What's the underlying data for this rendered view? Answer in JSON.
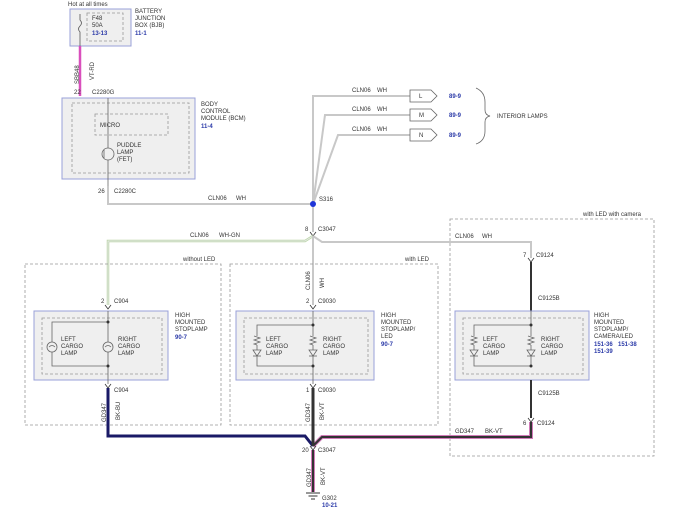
{
  "colors": {
    "wire": "#c8c8c8",
    "wire_pink": "#d94fbd",
    "ground_wire": "#333333",
    "ground_pink": "#d07ab8",
    "module_border": "#9aa0d8",
    "module_fill": "#efefef",
    "dash": "#999999",
    "ref": "#2b3aa8",
    "splice": "#1f35d8"
  },
  "top_note": "Hot at all times",
  "fuse": {
    "name": "F48",
    "rating": "50A",
    "ref": "13-13"
  },
  "bjb": {
    "line1": "BATTERY",
    "line2": "JUNCTION",
    "line3": "BOX (BJB)",
    "ref": "11-1"
  },
  "wire_top": {
    "circuit": "SBB48",
    "color": "VT-RD"
  },
  "bcm_top_conn": {
    "pin": "22",
    "name": "C2280G"
  },
  "bcm": {
    "line1": "BODY",
    "line2": "CONTROL",
    "line3": "MODULE (BCM)",
    "ref": "11-4"
  },
  "micro": "MICRO",
  "puddle": {
    "line1": "PUDDLE",
    "line2": "LAMP",
    "line3": "(FET)"
  },
  "bcm_bot_conn": {
    "pin": "26",
    "name": "C2280C"
  },
  "wire_s316": {
    "circuit": "CLN06",
    "color": "WH"
  },
  "splice_s316": "S316",
  "interior": {
    "circuit": "CLN06",
    "color": "WH",
    "rows": [
      {
        "conn": "L",
        "ref": "89-9"
      },
      {
        "conn": "M",
        "ref": "89-9"
      },
      {
        "conn": "N",
        "ref": "89-9"
      }
    ],
    "label": "INTERIOR LAMPS"
  },
  "c3047_top": {
    "pin": "8",
    "name": "C3047"
  },
  "wire_left": {
    "circuit": "CLN06",
    "color": "WH-GN"
  },
  "wire_right": {
    "circuit": "CLN06",
    "color": "WH"
  },
  "wire_mid_vert": {
    "circuit": "CLN06",
    "color": "WH"
  },
  "variant_left": "without LED",
  "variant_mid": "with LED",
  "variant_right": "with LED with camera",
  "left": {
    "top_conn": {
      "pin": "2",
      "name": "C904"
    },
    "bot_conn": {
      "pin": "",
      "name": "C904"
    },
    "lamp_l": {
      "line1": "LEFT",
      "line2": "CARGO",
      "line3": "LAMP"
    },
    "lamp_r": {
      "line1": "RIGHT",
      "line2": "CARGO",
      "line3": "LAMP"
    },
    "title": {
      "line1": "HIGH",
      "line2": "MOUNTED",
      "line3": "STOPLAMP",
      "ref": "90-7"
    },
    "gnd": {
      "circuit": "GD347",
      "color": "BK-BU"
    }
  },
  "mid": {
    "top_conn": {
      "pin": "2",
      "name": "C9030"
    },
    "bot_conn": {
      "pin": "1",
      "name": "C9030"
    },
    "lamp_l": {
      "line1": "LEFT",
      "line2": "CARGO",
      "line3": "LAMP"
    },
    "lamp_r": {
      "line1": "RIGHT",
      "line2": "CARGO",
      "line3": "LAMP"
    },
    "title": {
      "line1": "HIGH",
      "line2": "MOUNTED",
      "line3": "STOPLAMP/",
      "line4": "LED",
      "ref": "90-7"
    },
    "gnd": {
      "circuit": "GD347",
      "color": "BK-VT"
    }
  },
  "right": {
    "top_conn": {
      "pin": "7",
      "name": "C9124"
    },
    "mid_top": "C9125B",
    "mid_bot": "C9125B",
    "bot_conn": {
      "pin": "6",
      "name": "C9124"
    },
    "lamp_l": {
      "line1": "LEFT",
      "line2": "CARGO",
      "line3": "LAMP"
    },
    "lamp_r": {
      "line1": "RIGHT",
      "line2": "CARGO",
      "line3": "LAMP"
    },
    "title": {
      "line1": "HIGH",
      "line2": "MOUNTED",
      "line3": "STOPLAMP/",
      "line4": "CAMERA/LED",
      "ref1": "151-36",
      "ref2": "151-38",
      "ref3": "151-39"
    },
    "gnd": {
      "circuit": "GD347",
      "color": "BK-VT"
    }
  },
  "c3047_bot": {
    "pin": "20",
    "name": "C3047"
  },
  "ground_wire": {
    "circuit": "GD347",
    "color": "BK-VT"
  },
  "g302": {
    "name": "G302",
    "ref": "10-21"
  }
}
